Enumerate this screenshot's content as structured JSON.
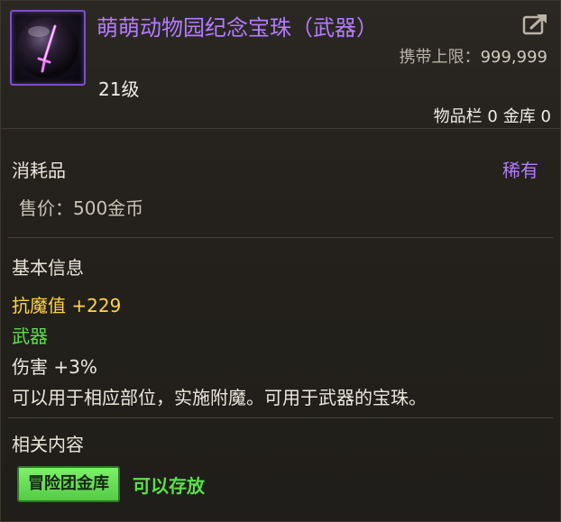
{
  "item": {
    "name": "萌萌动物园纪念宝珠（武器）",
    "level": "21级",
    "carry_limit_label": "携带上限：",
    "carry_limit_value": "999,999",
    "inventory_label": "物品栏 0",
    "bank_label": "金库 0",
    "icon": "purple-orb-sword-icon"
  },
  "meta": {
    "type": "消耗品",
    "rarity": "稀有",
    "price": "售价：500金币"
  },
  "basic_info": {
    "title": "基本信息",
    "stats": [
      "抗魔值 +229",
      "武器",
      "伤害 +3%",
      "可以用于相应部位，实施附魔。可用于武器的宝珠。"
    ]
  },
  "related": {
    "title": "相关内容",
    "badge": "冒险团金库",
    "status": "可以存放"
  },
  "colors": {
    "rarity_purple": "#b37bff",
    "stat_gold": "#ffd34a",
    "stat_green": "#5be04a"
  }
}
